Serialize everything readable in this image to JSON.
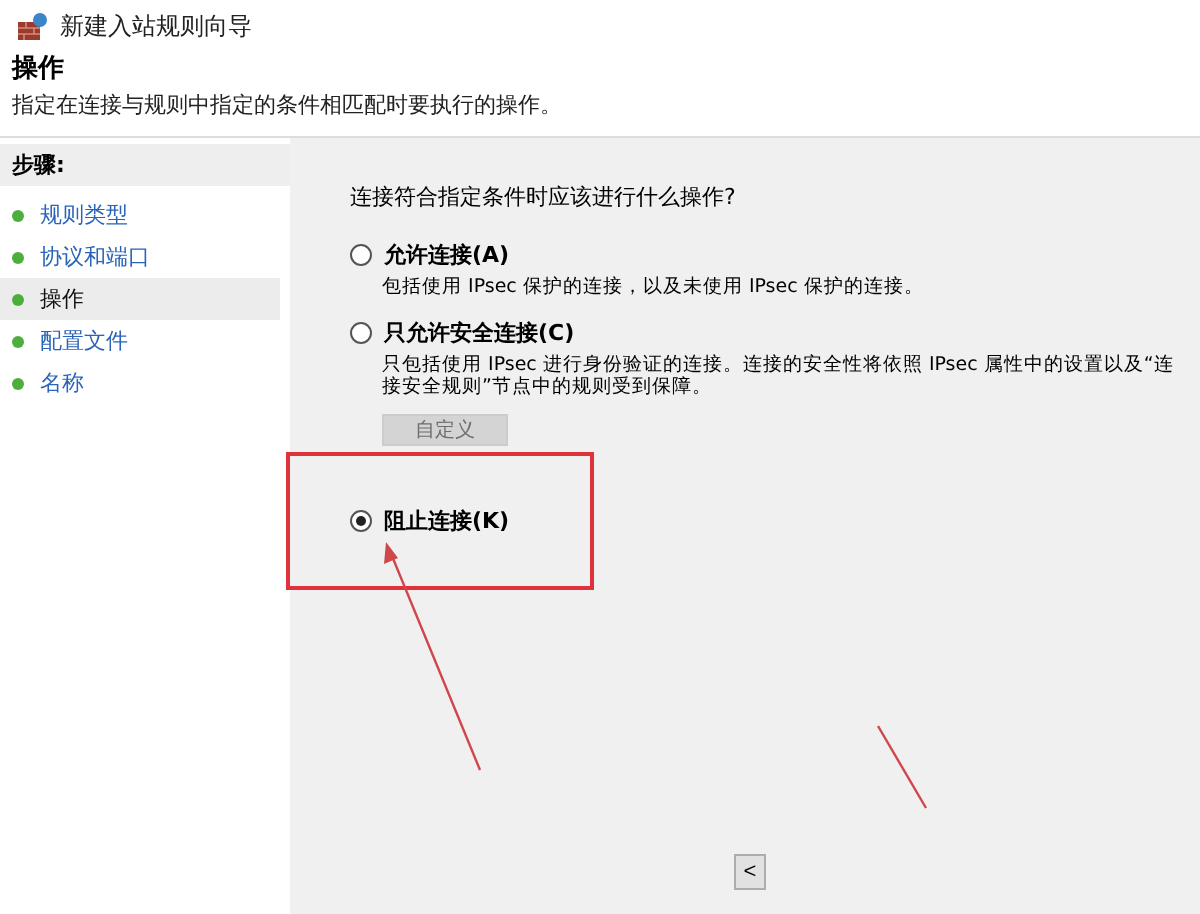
{
  "window": {
    "title": "新建入站规则向导"
  },
  "header": {
    "title": "操作",
    "description": "指定在连接与规则中指定的条件相匹配时要执行的操作。"
  },
  "steps": {
    "heading": "步骤:",
    "items": [
      {
        "label": "规则类型",
        "selected": false
      },
      {
        "label": "协议和端口",
        "selected": false
      },
      {
        "label": "操作",
        "selected": true
      },
      {
        "label": "配置文件",
        "selected": false
      },
      {
        "label": "名称",
        "selected": false
      }
    ]
  },
  "question": "连接符合指定条件时应该进行什么操作?",
  "options": [
    {
      "label": "允许连接(A)",
      "description": "包括使用 IPsec 保护的连接，以及未使用 IPsec 保护的连接。",
      "selected": false
    },
    {
      "label": "只允许安全连接(C)",
      "description": "只包括使用 IPsec 进行身份验证的连接。连接的安全性将依照 IPsec 属性中的设置以及“连接安全规则”节点中的规则受到保障。",
      "selected": false,
      "button": {
        "label": "自定义",
        "disabled": true
      }
    },
    {
      "label": "阻止连接(K)",
      "selected": true
    }
  ],
  "footer": {
    "back_button": "<"
  }
}
